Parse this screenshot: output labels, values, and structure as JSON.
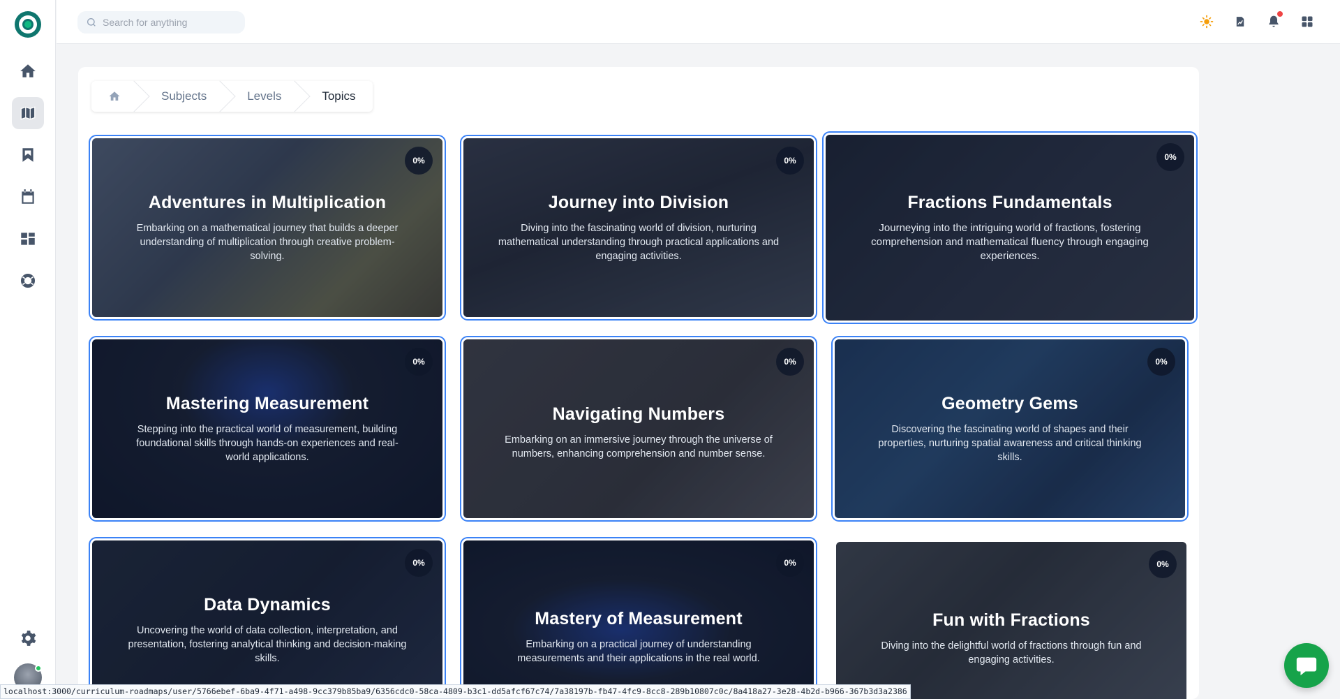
{
  "search": {
    "placeholder": "Search for anything"
  },
  "sidebar": {
    "items": [
      {
        "icon": "home-icon"
      },
      {
        "icon": "map-icon",
        "active": true
      },
      {
        "icon": "bookmark-icon"
      },
      {
        "icon": "calendar-icon"
      },
      {
        "icon": "dashboard-icon"
      },
      {
        "icon": "support-icon"
      }
    ],
    "settings_icon": "gear-icon"
  },
  "topbar": {
    "icons": [
      "sun-icon",
      "report-icon",
      "bell-icon",
      "apps-grid-icon"
    ]
  },
  "breadcrumb": {
    "home_icon": "home-icon",
    "items": [
      "Subjects",
      "Levels",
      "Topics"
    ]
  },
  "cards": [
    {
      "title": "Adventures in Multiplication",
      "description": "Embarking on a mathematical journey that builds a deeper understanding of multiplication through creative problem-solving.",
      "progress": "0%"
    },
    {
      "title": "Journey into Division",
      "description": "Diving into the fascinating world of division, nurturing mathematical understanding through practical applications and engaging activities.",
      "progress": "0%"
    },
    {
      "title": "Fractions Fundamentals",
      "description": "Journeying into the intriguing world of fractions, fostering comprehension and mathematical fluency through engaging experiences.",
      "progress": "0%"
    },
    {
      "title": "Mastering Measurement",
      "description": "Stepping into the practical world of measurement, building foundational skills through hands-on experiences and real-world applications.",
      "progress": "0%"
    },
    {
      "title": "Navigating Numbers",
      "description": "Embarking on an immersive journey through the universe of numbers, enhancing comprehension and number sense.",
      "progress": "0%"
    },
    {
      "title": "Geometry Gems",
      "description": "Discovering the fascinating world of shapes and their properties, nurturing spatial awareness and critical thinking skills.",
      "progress": "0%"
    },
    {
      "title": "Data Dynamics",
      "description": "Uncovering the world of data collection, interpretation, and presentation, fostering analytical thinking and decision-making skills.",
      "progress": "0%"
    },
    {
      "title": "Mastery of Measurement",
      "description": "Embarking on a practical journey of understanding measurements and their applications in the real world.",
      "progress": "0%"
    },
    {
      "title": "Fun with Fractions",
      "description": "Diving into the delightful world of fractions through fun and engaging activities.",
      "progress": "0%"
    }
  ],
  "chat": {
    "icon": "chat-icon"
  },
  "status_bar": {
    "url": "localhost:3000/curriculum-roadmaps/user/5766ebef-6ba9-4f71-a498-9cc379b85ba9/6356cdc0-58ca-4809-b3c1-dd5afcf67c74/7a38197b-fb47-4fc9-8cc8-289b10807c0c/8a418a27-3e28-4b2d-b966-367b3d3a2386"
  },
  "colors": {
    "accent": "#3b82f6",
    "brand": "#0f766e",
    "chat": "#16a34a",
    "notification": "#ef4444",
    "sun": "#f59e0b"
  }
}
